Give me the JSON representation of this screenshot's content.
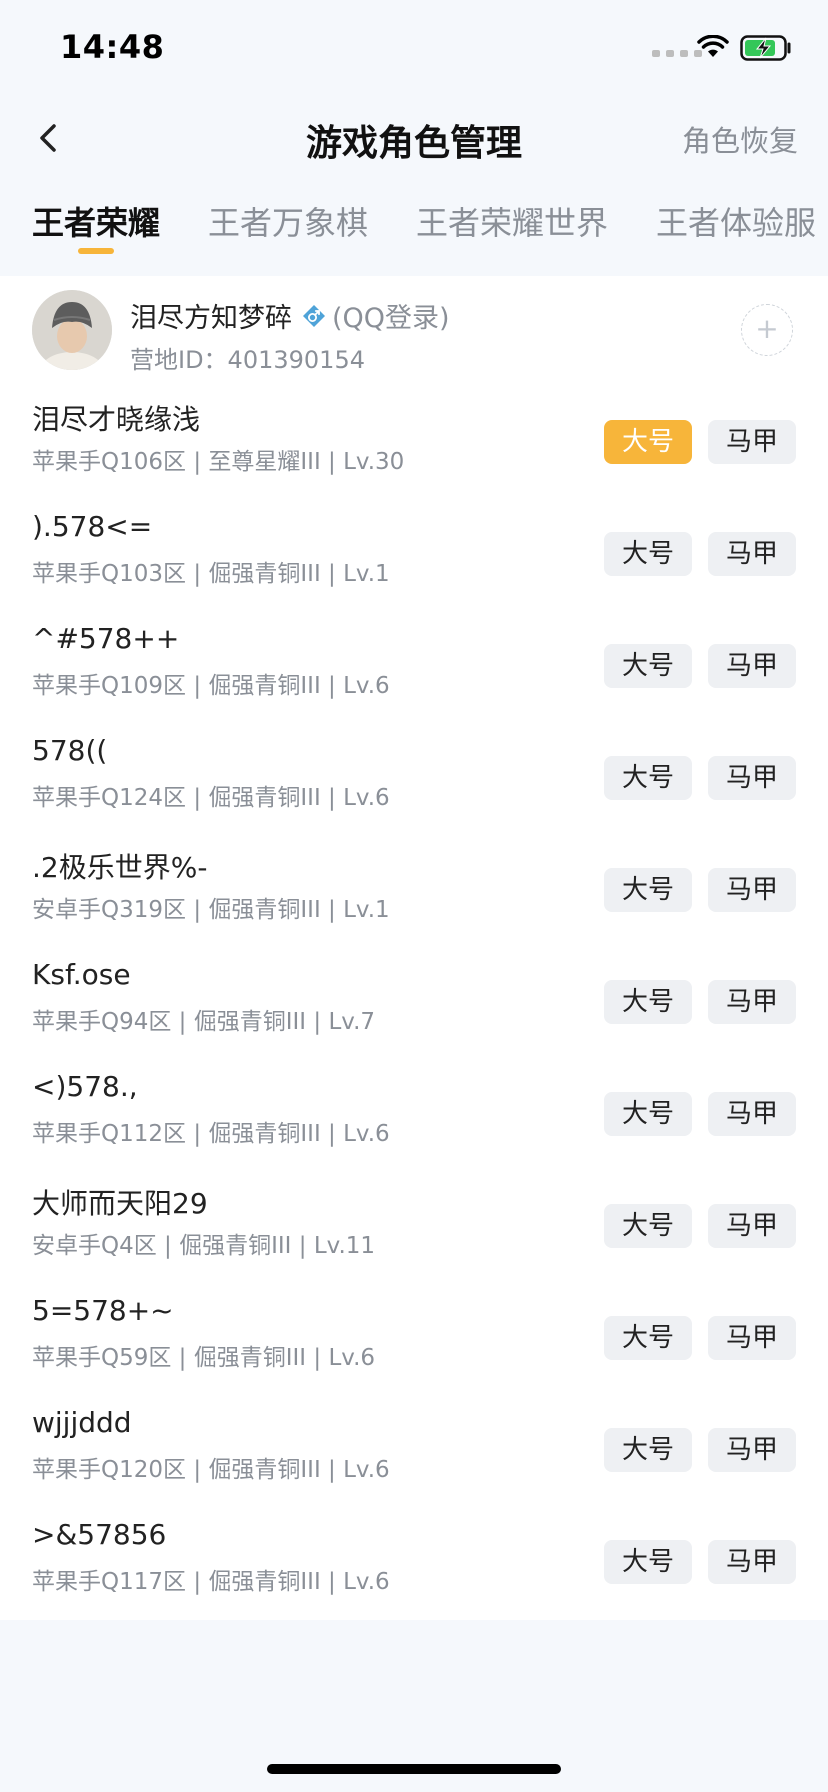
{
  "status_bar": {
    "time": "14:48"
  },
  "header": {
    "title": "游戏角色管理",
    "restore_label": "角色恢复"
  },
  "tabs": [
    {
      "label": "王者荣耀",
      "active": true
    },
    {
      "label": "王者万象棋",
      "active": false
    },
    {
      "label": "王者荣耀世界",
      "active": false
    },
    {
      "label": "王者体验服",
      "active": false
    }
  ],
  "profile": {
    "name": "泪尽方知梦碎",
    "login_type": "(QQ登录)",
    "camp_id": "营地ID：401390154",
    "add_label": "+"
  },
  "buttons": {
    "main_label": "大号",
    "alt_label": "马甲"
  },
  "colors": {
    "accent": "#f7b53a",
    "gender_badge": "#4fa3d8"
  },
  "roles": [
    {
      "name": "泪尽才晓缘浅",
      "meta": "苹果手Q106区 | 至尊星耀III | Lv.30",
      "main_selected": true
    },
    {
      "name": ").578<=",
      "meta": "苹果手Q103区 | 倔强青铜III | Lv.1",
      "main_selected": false
    },
    {
      "name": "^#578++",
      "meta": "苹果手Q109区 | 倔强青铜III | Lv.6",
      "main_selected": false
    },
    {
      "name": "578((",
      "meta": "苹果手Q124区 | 倔强青铜III | Lv.6",
      "main_selected": false
    },
    {
      "name": ".2极乐世界%-",
      "meta": "安卓手Q319区 | 倔强青铜III | Lv.1",
      "main_selected": false
    },
    {
      "name": "Ksf.ose",
      "meta": "苹果手Q94区 | 倔强青铜III | Lv.7",
      "main_selected": false
    },
    {
      "name": "<)578.,",
      "meta": "苹果手Q112区 | 倔强青铜III | Lv.6",
      "main_selected": false
    },
    {
      "name": "大师而天阳29",
      "meta": "安卓手Q4区 | 倔强青铜III | Lv.11",
      "main_selected": false
    },
    {
      "name": "5=578+~",
      "meta": "苹果手Q59区 | 倔强青铜III | Lv.6",
      "main_selected": false
    },
    {
      "name": "wjjjddd",
      "meta": "苹果手Q120区 | 倔强青铜III | Lv.6",
      "main_selected": false
    },
    {
      "name": ">&57856",
      "meta": "苹果手Q117区 | 倔强青铜III | Lv.6",
      "main_selected": false
    }
  ]
}
